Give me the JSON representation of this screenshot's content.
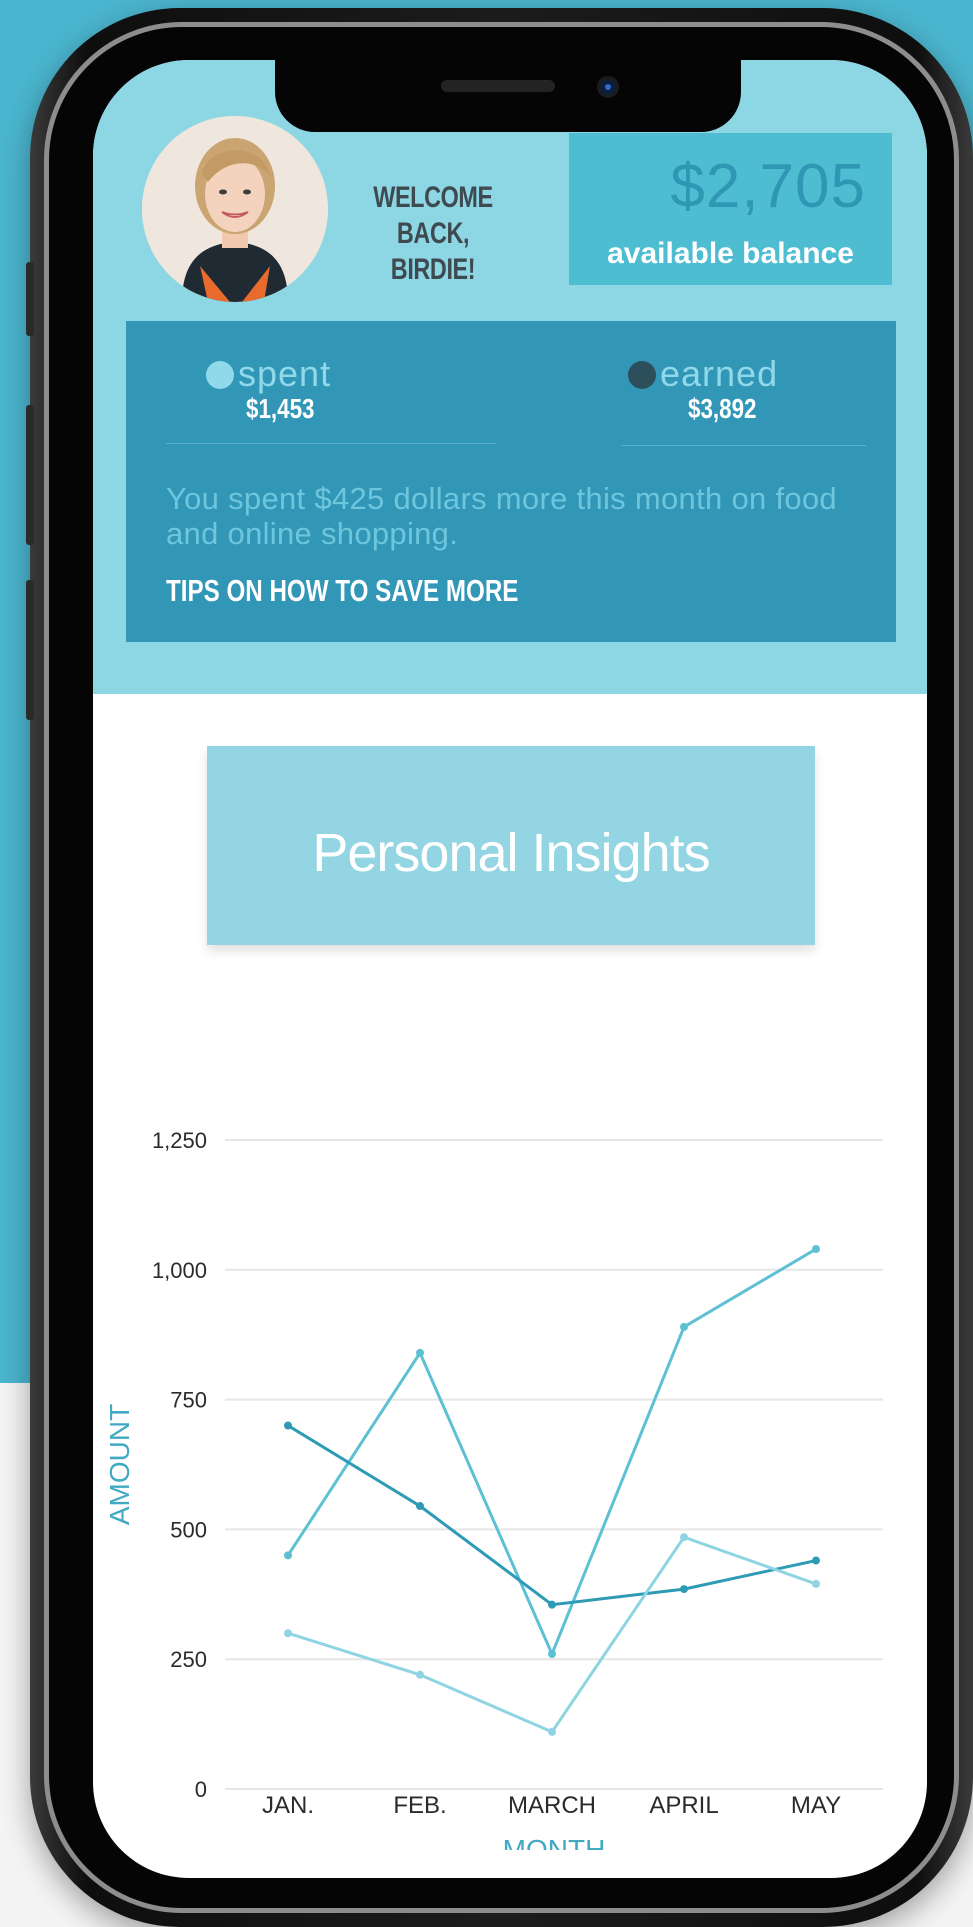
{
  "header": {
    "welcome_line1": "WELCOME BACK,",
    "welcome_line2": "BIRDIE!",
    "balance_amount": "$2,705",
    "balance_label": "available balance"
  },
  "summary": {
    "spent_label": "spent",
    "spent_value": "$1,453",
    "earned_label": "earned",
    "earned_value": "$3,892",
    "insight_text": "You spent $425 dollars more this month on food and online shopping.",
    "tips_link": "TIPS ON HOW TO SAVE MORE"
  },
  "insights": {
    "title": "Personal Insights"
  },
  "colors": {
    "background": "#4bb6cf",
    "header_bg": "#8dd6e4",
    "balance_box": "#4ebdd2",
    "card_bg": "#3296b7",
    "spent_dot": "#8fd9ea",
    "earned_dot": "#2d4f5c",
    "series_a": "#5ec0d3",
    "series_b": "#2e9bb5",
    "series_c": "#8fd4e2",
    "axis_title": "#41a9c2"
  },
  "chart_data": {
    "type": "line",
    "xlabel": "MONTH",
    "ylabel": "AMOUNT",
    "categories": [
      "JAN.",
      "FEB.",
      "MARCH",
      "APRIL",
      "MAY"
    ],
    "y_ticks": [
      "0",
      "250",
      "500",
      "750",
      "1,000",
      "1,250"
    ],
    "ylim": [
      0,
      1250
    ],
    "grid": true,
    "series": [
      {
        "values": [
          450,
          840,
          260,
          890,
          1040
        ]
      },
      {
        "values": [
          700,
          545,
          355,
          385,
          440
        ]
      },
      {
        "values": [
          300,
          220,
          110,
          485,
          395
        ]
      }
    ]
  }
}
